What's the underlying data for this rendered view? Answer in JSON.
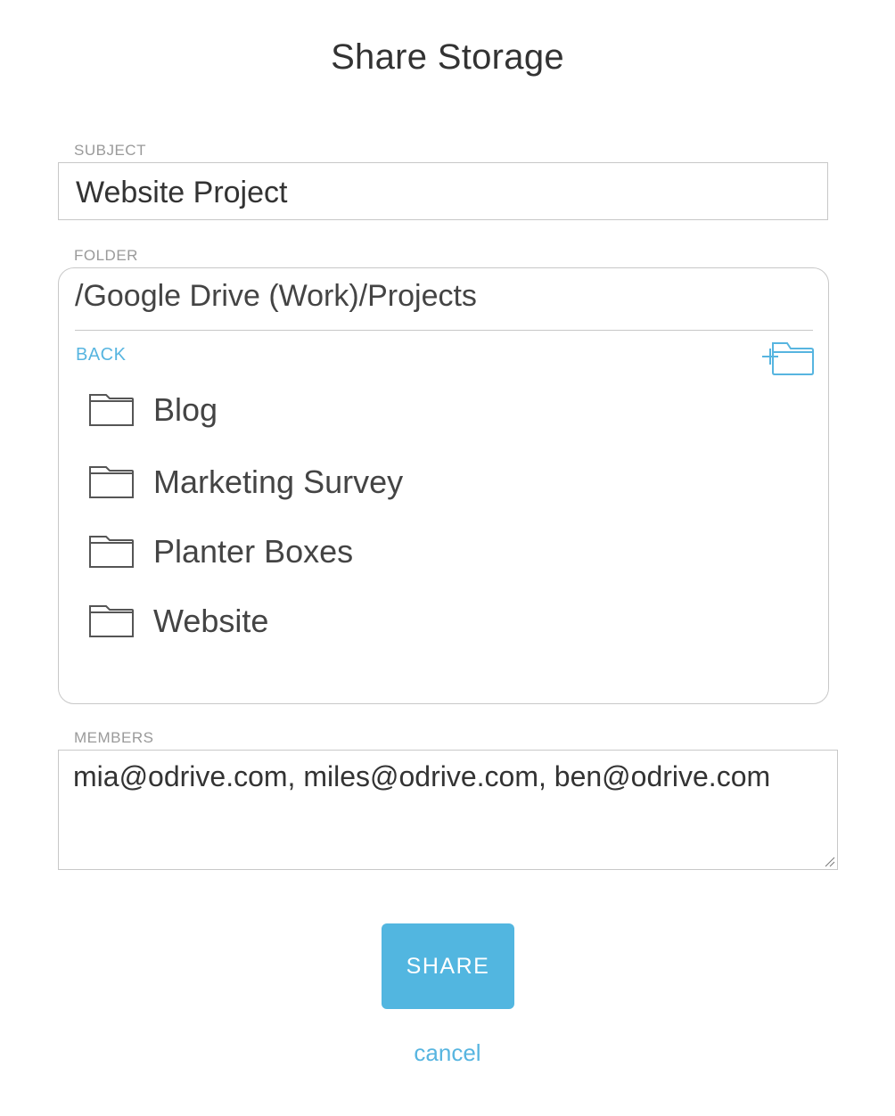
{
  "dialog": {
    "title": "Share Storage"
  },
  "subject": {
    "label": "SUBJECT",
    "value": "Website Project"
  },
  "folder": {
    "label": "FOLDER",
    "path": "/Google Drive (Work)/Projects",
    "back_label": "BACK",
    "new_folder_icon": "new-folder-icon",
    "items": [
      {
        "name": "Blog",
        "icon": "folder-icon"
      },
      {
        "name": "Marketing Survey",
        "icon": "folder-icon"
      },
      {
        "name": "Planter Boxes",
        "icon": "folder-icon"
      },
      {
        "name": "Website",
        "icon": "folder-icon"
      }
    ]
  },
  "members": {
    "label": "MEMBERS",
    "value": "mia@odrive.com, miles@odrive.com, ben@odrive.com"
  },
  "actions": {
    "share_label": "SHARE",
    "cancel_label": "cancel"
  },
  "colors": {
    "accent": "#52b6e0",
    "link": "#57b5e0",
    "border": "#c8c8c8",
    "label": "#9a9a9a"
  }
}
